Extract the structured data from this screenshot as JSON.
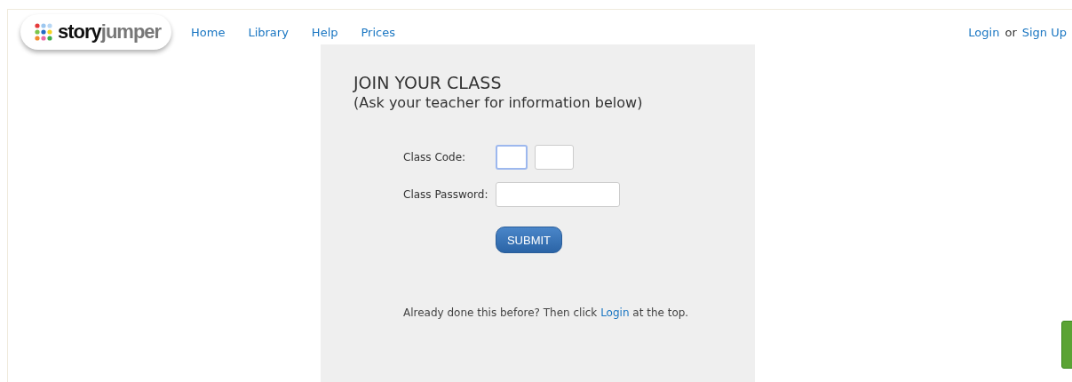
{
  "header": {
    "logo": {
      "part_1": "story",
      "part_2": "jumper"
    },
    "nav": [
      {
        "label": "Home"
      },
      {
        "label": "Library"
      },
      {
        "label": "Help"
      },
      {
        "label": "Prices"
      }
    ],
    "account": {
      "login": "Login",
      "separator": "or",
      "signup": "Sign Up"
    }
  },
  "form": {
    "title": "JOIN YOUR CLASS",
    "subtitle": "(Ask your teacher for information below)",
    "class_code": {
      "label": "Class Code:",
      "fields": [
        {
          "focused": true
        },
        {
          "focused": false
        }
      ]
    },
    "class_password": {
      "label": "Class Password:"
    },
    "submit": "SUBMIT",
    "footer": {
      "before": "Already done this before? Then click ",
      "link": "Login",
      "after": " at the top."
    }
  }
}
